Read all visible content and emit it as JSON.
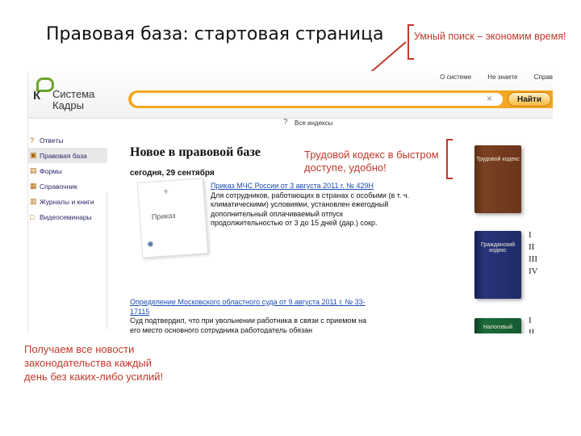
{
  "slide": {
    "title": "Правовая база: стартовая страница",
    "callout_top": "Умный поиск – экономим время!",
    "callout_mid": "Трудовой кодекс в быстром доступе, удобно!",
    "callout_bottom": "Получаем все новости законодательства каждый день без каких-либо усилий!"
  },
  "app": {
    "logo_line1": "Система",
    "logo_line2": "Кадры",
    "top_links": [
      "О системе",
      "Не знаете",
      "Справ"
    ],
    "search_placeholder": "",
    "clear_symbol": "×",
    "find_button": "Найти",
    "help_link": "Все индексы",
    "sidebar": [
      {
        "label": "Ответы",
        "icon": "?",
        "active": false
      },
      {
        "label": "Правовая база",
        "icon": "▣",
        "active": true
      },
      {
        "label": "Формы",
        "icon": "▤",
        "active": false
      },
      {
        "label": "Справочник",
        "icon": "▦",
        "active": false
      },
      {
        "label": "Журналы и книги",
        "icon": "▥",
        "active": false
      },
      {
        "label": "Видеосеминары",
        "icon": "□",
        "active": false
      }
    ],
    "main_heading": "Новое в правовой базе",
    "date": "сегодня, 29 сентября",
    "doc_thumb_label": "Приказ",
    "news_1": {
      "link": "Приказ МЧС России от 3 августа 2011 г. № 429Н",
      "text": "Для сотрудников, работающих в странах с особыми (в т. ч. климатическими) условиями, установлен ежегодный дополнительный оплачиваемый отпуск продолжительностью от 3 до 15 дней (дар.) сокр."
    },
    "news_2": {
      "link": "Определение Московского областного суда от 9 августа 2011 г. № 33-17115",
      "text": "Суд подтвердил, что при увольнении работника в связи с приемом на его место основного сотрудника работодатель обязан"
    },
    "books": [
      {
        "label": "Трудовой кодекс"
      },
      {
        "label": "Гражданский кодекс"
      },
      {
        "label": "Налоговый"
      }
    ],
    "roman_1": [
      "I",
      "II",
      "III",
      "IV"
    ],
    "roman_2": [
      "I",
      "II"
    ]
  }
}
